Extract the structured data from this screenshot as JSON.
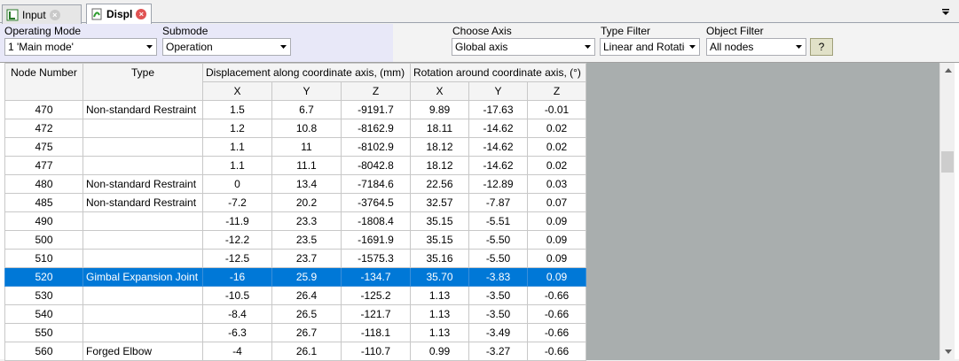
{
  "tabs": [
    {
      "label": "Input",
      "active": false,
      "icon": "input-table-icon"
    },
    {
      "label": "Displ",
      "active": true,
      "icon": "displacement-icon"
    }
  ],
  "filters": {
    "operating_mode": {
      "label": "Operating Mode",
      "value": "1 'Main mode'"
    },
    "submode": {
      "label": "Submode",
      "value": "Operation"
    },
    "choose_axis": {
      "label": "Choose Axis",
      "value": "Global axis"
    },
    "type_filter": {
      "label": "Type Filter",
      "value": "Linear and Rotatio"
    },
    "object_filter": {
      "label": "Object Filter",
      "value": "All nodes"
    },
    "help_label": "?"
  },
  "grid": {
    "headers": {
      "node_number": "Node Number",
      "type": "Type",
      "displacement": "Displacement along coordinate axis, (mm)",
      "rotation": "Rotation around coordinate axis, (°)",
      "x": "X",
      "y": "Y",
      "z": "Z"
    },
    "rows": [
      {
        "node": "470",
        "type": "Non-standard Restraint",
        "dx": "1.5",
        "dy": "6.7",
        "dz": "-9191.7",
        "rx": "9.89",
        "ry": "-17.63",
        "rz": "-0.01"
      },
      {
        "node": "472",
        "type": "",
        "dx": "1.2",
        "dy": "10.8",
        "dz": "-8162.9",
        "rx": "18.11",
        "ry": "-14.62",
        "rz": "0.02"
      },
      {
        "node": "475",
        "type": "",
        "dx": "1.1",
        "dy": "11",
        "dz": "-8102.9",
        "rx": "18.12",
        "ry": "-14.62",
        "rz": "0.02"
      },
      {
        "node": "477",
        "type": "",
        "dx": "1.1",
        "dy": "11.1",
        "dz": "-8042.8",
        "rx": "18.12",
        "ry": "-14.62",
        "rz": "0.02"
      },
      {
        "node": "480",
        "type": "Non-standard Restraint",
        "dx": "0",
        "dy": "13.4",
        "dz": "-7184.6",
        "rx": "22.56",
        "ry": "-12.89",
        "rz": "0.03"
      },
      {
        "node": "485",
        "type": "Non-standard Restraint",
        "dx": "-7.2",
        "dy": "20.2",
        "dz": "-3764.5",
        "rx": "32.57",
        "ry": "-7.87",
        "rz": "0.07"
      },
      {
        "node": "490",
        "type": "",
        "dx": "-11.9",
        "dy": "23.3",
        "dz": "-1808.4",
        "rx": "35.15",
        "ry": "-5.51",
        "rz": "0.09"
      },
      {
        "node": "500",
        "type": "",
        "dx": "-12.2",
        "dy": "23.5",
        "dz": "-1691.9",
        "rx": "35.15",
        "ry": "-5.50",
        "rz": "0.09"
      },
      {
        "node": "510",
        "type": "",
        "dx": "-12.5",
        "dy": "23.7",
        "dz": "-1575.3",
        "rx": "35.16",
        "ry": "-5.50",
        "rz": "0.09"
      },
      {
        "node": "520",
        "type": "Gimbal Expansion Joint",
        "dx": "-16",
        "dy": "25.9",
        "dz": "-134.7",
        "rx": "35.70",
        "ry": "-3.83",
        "rz": "0.09",
        "selected": true
      },
      {
        "node": "530",
        "type": "",
        "dx": "-10.5",
        "dy": "26.4",
        "dz": "-125.2",
        "rx": "1.13",
        "ry": "-3.50",
        "rz": "-0.66"
      },
      {
        "node": "540",
        "type": "",
        "dx": "-8.4",
        "dy": "26.5",
        "dz": "-121.7",
        "rx": "1.13",
        "ry": "-3.50",
        "rz": "-0.66"
      },
      {
        "node": "550",
        "type": "",
        "dx": "-6.3",
        "dy": "26.7",
        "dz": "-118.1",
        "rx": "1.13",
        "ry": "-3.49",
        "rz": "-0.66"
      },
      {
        "node": "560",
        "type": "Forged Elbow",
        "dx": "-4",
        "dy": "26.1",
        "dz": "-110.7",
        "rx": "0.99",
        "ry": "-3.27",
        "rz": "-0.66"
      }
    ]
  },
  "colors": {
    "selection": "#0078d7",
    "grid_background": "#a9aeae"
  }
}
